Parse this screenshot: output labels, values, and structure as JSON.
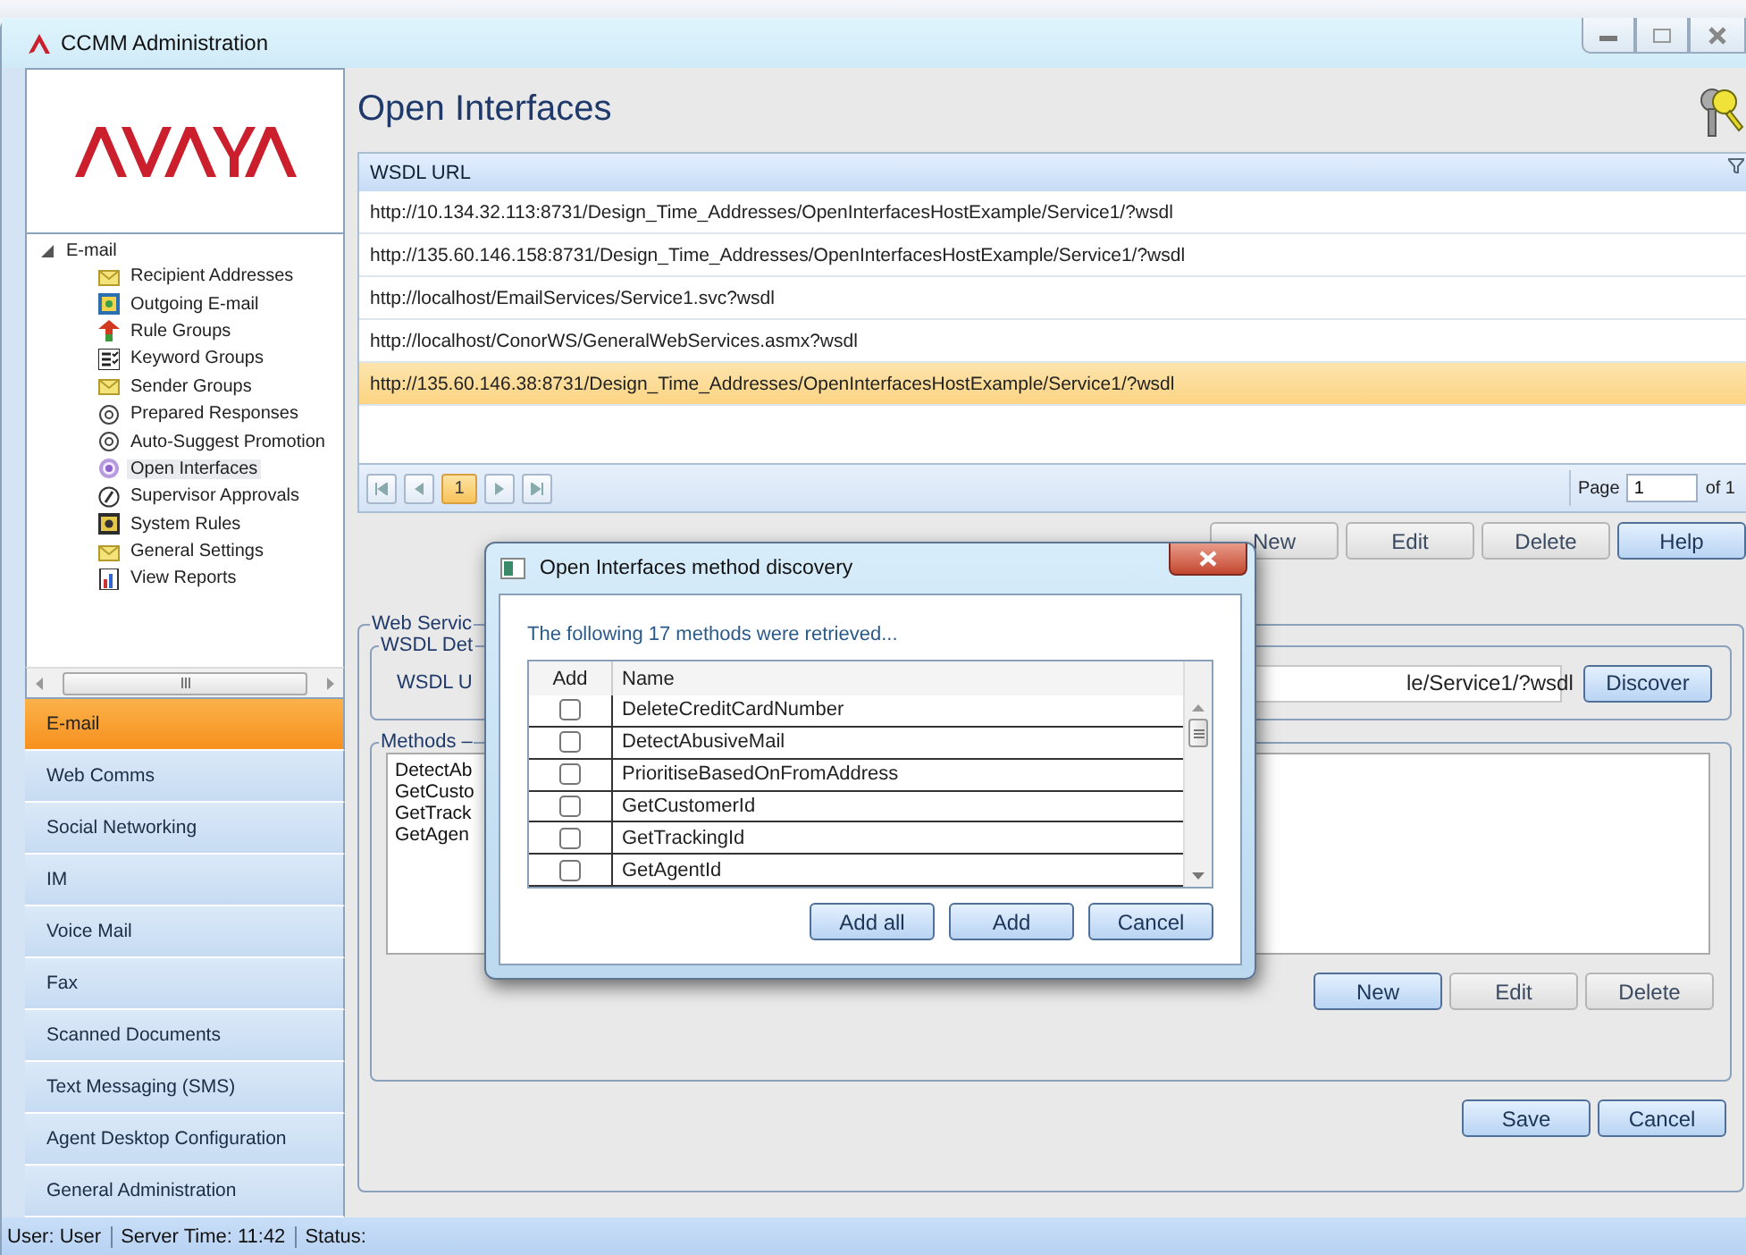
{
  "window": {
    "title": "CCMM Administration"
  },
  "sidebar": {
    "tree": [
      {
        "label": "E-mail",
        "expanded": true,
        "children": [
          {
            "label": "Recipient Addresses",
            "selected": false
          },
          {
            "label": "Outgoing E-mail",
            "selected": false
          },
          {
            "label": "Rule Groups",
            "selected": false
          },
          {
            "label": "Keyword Groups",
            "selected": false
          },
          {
            "label": "Sender Groups",
            "selected": false
          },
          {
            "label": "Prepared Responses",
            "selected": false
          },
          {
            "label": "Auto-Suggest Promotion",
            "selected": false
          },
          {
            "label": "Open Interfaces",
            "selected": true
          },
          {
            "label": "Supervisor Approvals",
            "selected": false
          },
          {
            "label": "System Rules",
            "selected": false
          },
          {
            "label": "General Settings",
            "selected": false
          },
          {
            "label": "View Reports",
            "selected": false
          }
        ]
      }
    ],
    "nav": [
      {
        "label": "E-mail",
        "selected": true
      },
      {
        "label": "Web Comms",
        "selected": false
      },
      {
        "label": "Social Networking",
        "selected": false
      },
      {
        "label": "IM",
        "selected": false
      },
      {
        "label": "Voice Mail",
        "selected": false
      },
      {
        "label": "Fax",
        "selected": false
      },
      {
        "label": "Scanned Documents",
        "selected": false
      },
      {
        "label": "Text Messaging (SMS)",
        "selected": false
      },
      {
        "label": "Agent Desktop Configuration",
        "selected": false
      },
      {
        "label": "General Administration",
        "selected": false
      }
    ]
  },
  "main": {
    "title": "Open Interfaces",
    "grid": {
      "columns": [
        "WSDL URL"
      ],
      "rows": [
        {
          "url": "http://10.134.32.113:8731/Design_Time_Addresses/OpenInterfacesHostExample/Service1/?wsdl",
          "selected": false
        },
        {
          "url": "http://135.60.146.158:8731/Design_Time_Addresses/OpenInterfacesHostExample/Service1/?wsdl",
          "selected": false
        },
        {
          "url": "http://localhost/EmailServices/Service1.svc?wsdl",
          "selected": false
        },
        {
          "url": "http://localhost/ConorWS/GeneralWebServices.asmx?wsdl",
          "selected": false
        },
        {
          "url": "http://135.60.146.38:8731/Design_Time_Addresses/OpenInterfacesHostExample/Service1/?wsdl",
          "selected": true
        }
      ],
      "pager": {
        "pages": [
          {
            "label": "1",
            "selected": true
          }
        ],
        "page_label": "Page",
        "page_value": "1",
        "page_total": "of 1"
      }
    },
    "buttons": [
      {
        "label": "New",
        "default": false
      },
      {
        "label": "Edit",
        "default": false
      },
      {
        "label": "Delete",
        "default": false
      },
      {
        "label": "Help",
        "default": true
      }
    ],
    "web_service": {
      "legend": "Web Servic",
      "wsdl": {
        "legend": "WSDL Det",
        "label": "WSDL U",
        "value": "le/Service1/?wsdl",
        "button": "Discover"
      },
      "methods": {
        "legend": "Methods –",
        "items": [
          "DetectAb",
          "GetCusto",
          "GetTrack",
          "GetAgen"
        ],
        "buttons": [
          {
            "label": "New",
            "default": true
          },
          {
            "label": "Edit",
            "default": false
          },
          {
            "label": "Delete",
            "default": false
          }
        ]
      },
      "buttons": [
        {
          "label": "Save",
          "default": true
        },
        {
          "label": "Cancel",
          "default": true
        }
      ]
    }
  },
  "dialog": {
    "title": "Open Interfaces method discovery",
    "message": "The following 17 methods were retrieved...",
    "columns": [
      "Add",
      "Name"
    ],
    "methods": [
      {
        "name": "DeleteCreditCardNumber",
        "checked": false
      },
      {
        "name": "DetectAbusiveMail",
        "checked": false
      },
      {
        "name": "PrioritiseBasedOnFromAddress",
        "checked": false
      },
      {
        "name": "GetCustomerId",
        "checked": false
      },
      {
        "name": "GetTrackingId",
        "checked": false
      },
      {
        "name": "GetAgentId",
        "checked": false
      }
    ],
    "buttons": [
      {
        "label": "Add all",
        "default": true
      },
      {
        "label": "Add",
        "default": true
      },
      {
        "label": "Cancel",
        "default": true
      }
    ]
  },
  "status_bar": {
    "items": [
      "User: User",
      "Server Time: 11:42",
      "Status:"
    ]
  }
}
